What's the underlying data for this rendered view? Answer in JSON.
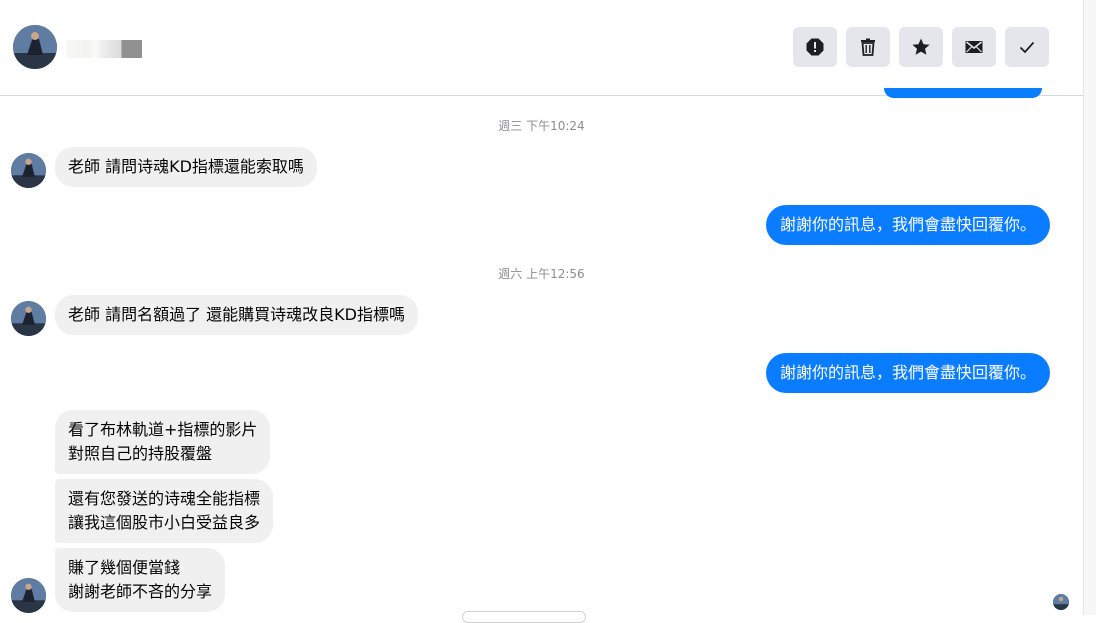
{
  "header": {
    "contact_name": "",
    "actions": [
      {
        "label": "report",
        "icon": "alert-icon"
      },
      {
        "label": "delete",
        "icon": "trash-icon"
      },
      {
        "label": "star",
        "icon": "star-icon"
      },
      {
        "label": "mark-unread",
        "icon": "envelope-icon"
      },
      {
        "label": "done",
        "icon": "check-icon"
      }
    ]
  },
  "conversation": {
    "timestamps": [
      "週三 下午10:24",
      "週六 上午12:56"
    ],
    "incoming": [
      {
        "text": "老師 請問诗魂KD指標還能索取嗎"
      },
      {
        "text": "老師 請問名額過了 還能購買诗魂改良KD指標嗎"
      },
      {
        "text": "看了布林軌道+指標的影片\n對照自己的持股覆盤"
      },
      {
        "text": "還有您發送的诗魂全能指標\n讓我這個股市小白受益良多"
      },
      {
        "text": "賺了幾個便當錢\n謝謝老師不吝的分享"
      }
    ],
    "outgoing": [
      {
        "text": "謝謝你的訊息，我們會盡快回覆你。"
      },
      {
        "text": "謝謝你的訊息，我們會盡快回覆你。"
      }
    ]
  },
  "colors": {
    "accent": "#0a7cff",
    "incoming_bg": "#f0f0f0",
    "button_bg": "#e4e6eb",
    "timestamp": "#8a8d91"
  }
}
